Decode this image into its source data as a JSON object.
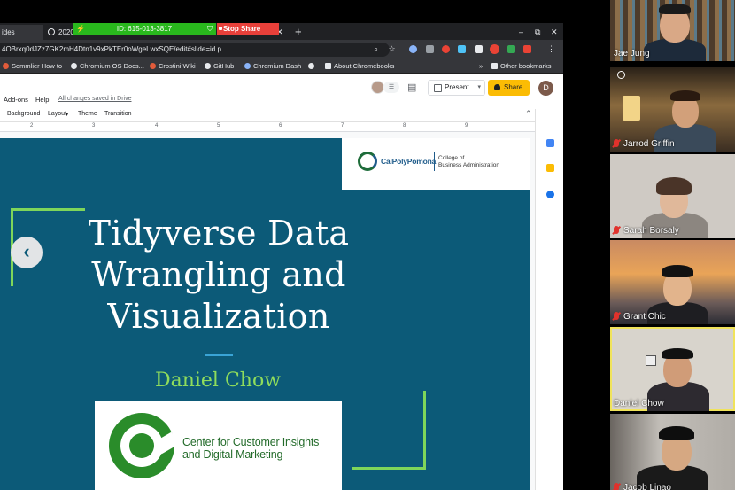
{
  "browser": {
    "tabs": [
      "ides",
      "2020"
    ],
    "share_banner": {
      "meeting_id": "ID: 615-013-3817",
      "stop_label": "Stop Share"
    },
    "new_tab": "+",
    "window_controls": [
      "–",
      "⧉",
      "✕"
    ],
    "url": "4OBrxq0dJZz7GK2mH4Dtn1v9xPkTEr0oWgeLwxSQE/edit#slide=id.p",
    "bookmarks": [
      "Sommlier How to",
      "Chromium OS Docs...",
      "Crostini Wiki",
      "GitHub",
      "Chromium Dash",
      "About Chromebooks"
    ],
    "bookmarks_overflow": "»",
    "other_bookmarks": "Other bookmarks"
  },
  "slides_app": {
    "menu": [
      "Add-ons",
      "Help"
    ],
    "save_status": "All changes saved in Drive",
    "present_label": "Present",
    "share_label": "Share",
    "user_initial": "D",
    "toolbar": [
      "Background",
      "Layout",
      "Theme",
      "Transition"
    ],
    "ruler_marks": [
      "2",
      "3",
      "4",
      "5",
      "6",
      "7",
      "8",
      "9"
    ]
  },
  "slide": {
    "title": "Tidyverse Data Wrangling and Visualization",
    "author": "Daniel Chow",
    "cpp_logo_name": "CalPolyPomona",
    "cpp_college_line1": "College of",
    "cpp_college_line2": "Business Administration",
    "cci_line1": "Center for Customer Insights",
    "cci_line2": "and Digital Marketing"
  },
  "participants": [
    {
      "name": "Jae Jung",
      "muted": false
    },
    {
      "name": "Jarrod Griffin",
      "muted": true
    },
    {
      "name": "Sarah Borsaly",
      "muted": true
    },
    {
      "name": "Grant Chic",
      "muted": true
    },
    {
      "name": "Daniel Chow",
      "muted": false,
      "speaking": true
    },
    {
      "name": "Jacob Linao",
      "muted": true
    }
  ],
  "colors": {
    "slide_bg": "#0c5a78",
    "accent_green": "#7fd65a",
    "share_green": "#29b81d",
    "stop_red": "#e8403a",
    "share_yellow": "#fbbc04"
  }
}
